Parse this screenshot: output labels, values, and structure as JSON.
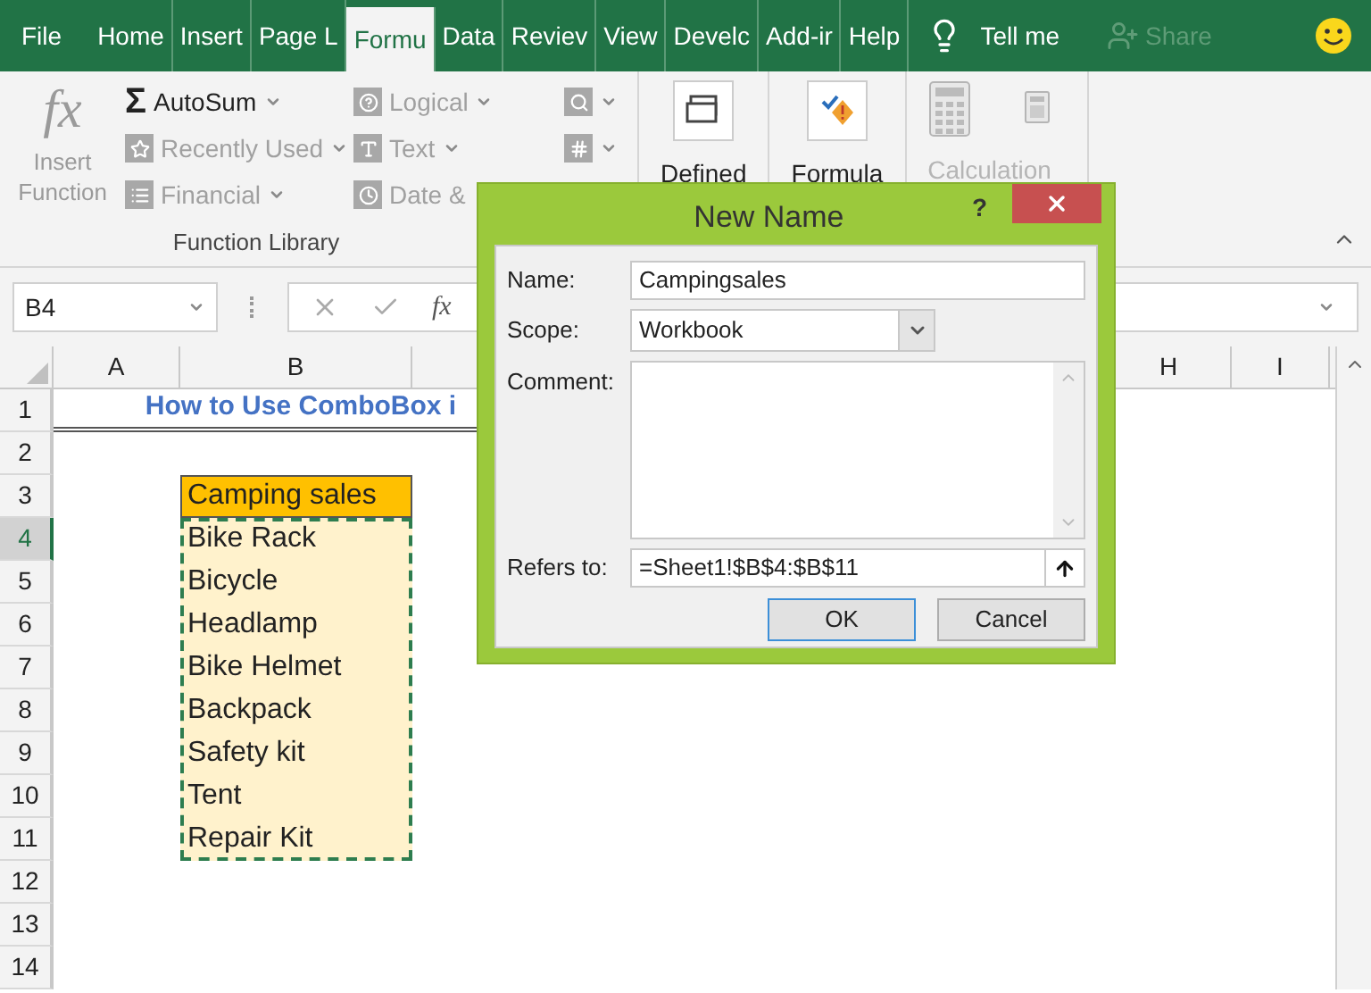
{
  "ribbon_tabs": [
    {
      "label": "File",
      "selected": false
    },
    {
      "label": "Home",
      "selected": false
    },
    {
      "label": "Insert",
      "selected": false
    },
    {
      "label": "Page L",
      "selected": false
    },
    {
      "label": "Formu",
      "selected": true
    },
    {
      "label": "Data",
      "selected": false
    },
    {
      "label": "Reviev",
      "selected": false
    },
    {
      "label": "View",
      "selected": false
    },
    {
      "label": "Develc",
      "selected": false
    },
    {
      "label": "Add-ir",
      "selected": false
    },
    {
      "label": "Help",
      "selected": false
    }
  ],
  "tell_me": "Tell me",
  "share": {
    "label": "Share",
    "disabled": true
  },
  "ribbon": {
    "insert_function": {
      "symbol": "fx",
      "label": "Insert Function",
      "disabled": true
    },
    "autosum": {
      "symbol": "Σ",
      "label": "AutoSum",
      "disabled": false
    },
    "functions": [
      {
        "label": "Recently Used",
        "disabled": true
      },
      {
        "label": "Financial",
        "disabled": true
      },
      {
        "label": "Logical",
        "disabled": true
      },
      {
        "label": "Text",
        "disabled": true
      },
      {
        "label": "Date &",
        "disabled": true
      }
    ],
    "group_label": "Function Library",
    "large_buttons": [
      {
        "label": "Defined",
        "disabled": false
      },
      {
        "label": "Formula",
        "disabled": false
      },
      {
        "label": "Calculation",
        "disabled": true
      }
    ]
  },
  "name_box": "B4",
  "formula_bar": {
    "symbol": "fx"
  },
  "columns": [
    "A",
    "B",
    "H",
    "I"
  ],
  "rows": [
    {
      "number": "1",
      "kind": "title",
      "text": "How to Use ComboBox i",
      "selected": false
    },
    {
      "number": "2",
      "kind": "blank",
      "selected": false
    },
    {
      "number": "3",
      "kind": "header",
      "text": "Camping sales",
      "selected": false
    },
    {
      "number": "4",
      "kind": "item",
      "text": "Bike Rack",
      "selected": true
    },
    {
      "number": "5",
      "kind": "item",
      "text": "Bicycle",
      "selected": false
    },
    {
      "number": "6",
      "kind": "item",
      "text": "Headlamp",
      "selected": false
    },
    {
      "number": "7",
      "kind": "item",
      "text": "Bike Helmet",
      "selected": false
    },
    {
      "number": "8",
      "kind": "item",
      "text": "Backpack",
      "selected": false
    },
    {
      "number": "9",
      "kind": "item",
      "text": "Safety kit",
      "selected": false
    },
    {
      "number": "10",
      "kind": "item",
      "text": "Tent",
      "selected": false
    },
    {
      "number": "11",
      "kind": "item",
      "text": "Repair Kit",
      "selected": false
    },
    {
      "number": "12",
      "kind": "blank",
      "selected": false
    },
    {
      "number": "13",
      "kind": "blank",
      "selected": false
    },
    {
      "number": "14",
      "kind": "blank",
      "selected": false
    }
  ],
  "dialog": {
    "title": "New Name",
    "help": "?",
    "name": {
      "label": "Name:",
      "value": "Campingsales"
    },
    "scope": {
      "label": "Scope:",
      "value": "Workbook"
    },
    "comment": {
      "label": "Comment:"
    },
    "refers_to": {
      "label": "Refers to:",
      "value": "=Sheet1!$B$4:$B$11"
    },
    "buttons": [
      {
        "label": "OK",
        "kind": "default"
      },
      {
        "label": "Cancel",
        "kind": "normal"
      }
    ]
  }
}
